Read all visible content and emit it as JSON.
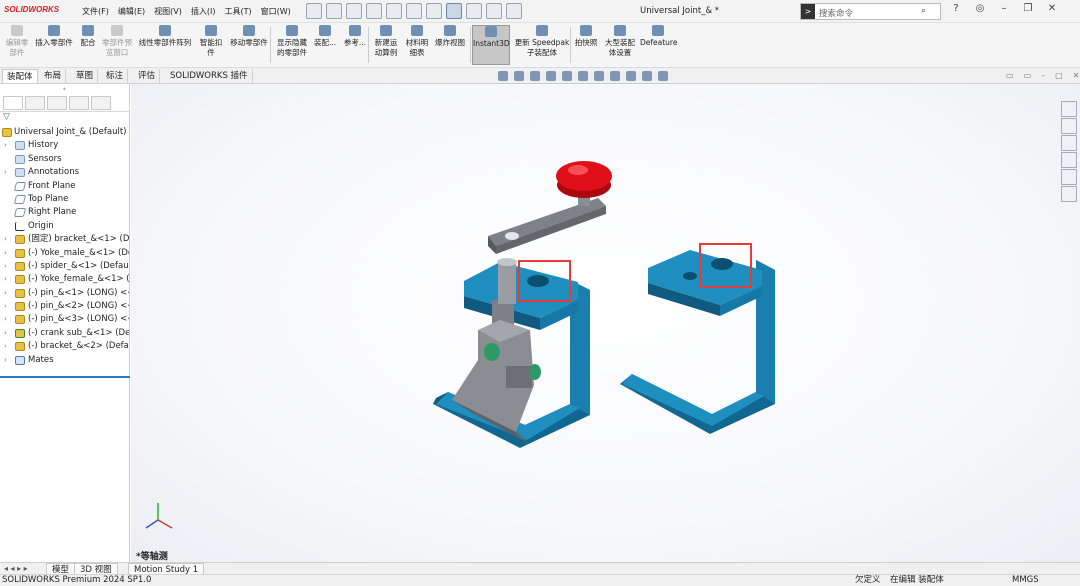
{
  "app": {
    "logo": "SOLIDWORKS",
    "window_title": "Universal Joint_& *",
    "menu": [
      "文件(F)",
      "编辑(E)",
      "视图(V)",
      "插入(I)",
      "工具(T)",
      "窗口(W)"
    ],
    "search_placeholder": "搜索命令"
  },
  "ribbon": {
    "buttons": [
      {
        "label": "编辑零\n部件",
        "dim": true
      },
      {
        "label": "插入零部件",
        "dim": false
      },
      {
        "label": "配合",
        "dim": false
      },
      {
        "label": "零部件预\n览窗口",
        "dim": true
      },
      {
        "label": "线性零部件阵列",
        "dim": false
      },
      {
        "label": "智能扣\n件",
        "dim": false
      },
      {
        "label": "移动零部件",
        "dim": false
      },
      {
        "label": "显示隐藏\n的零部件",
        "dim": false
      },
      {
        "label": "装配...",
        "dim": false
      },
      {
        "label": "参考...",
        "dim": false
      },
      {
        "label": "新建运\n动算例",
        "dim": false
      },
      {
        "label": "材料明\n细表",
        "dim": false
      },
      {
        "label": "爆炸视图",
        "dim": false
      },
      {
        "label": "Instant3D",
        "dim": false,
        "active": true
      },
      {
        "label": "更新 Speedpak\n子装配体",
        "dim": false
      },
      {
        "label": "拍快照",
        "dim": false
      },
      {
        "label": "大型装配\n体设置",
        "dim": false
      },
      {
        "label": "Defeature",
        "dim": false
      }
    ]
  },
  "command_tabs": [
    "装配体",
    "布局",
    "草图",
    "标注",
    "评估",
    "SOLIDWORKS 插件"
  ],
  "tree": {
    "root": "Universal Joint_& (Default) <",
    "items": [
      {
        "label": "History",
        "icon": "folder",
        "exp": true
      },
      {
        "label": "Sensors",
        "icon": "folder",
        "exp": false
      },
      {
        "label": "Annotations",
        "icon": "folder",
        "exp": true
      },
      {
        "label": "Front Plane",
        "icon": "plane",
        "exp": false
      },
      {
        "label": "Top Plane",
        "icon": "plane",
        "exp": false
      },
      {
        "label": "Right Plane",
        "icon": "plane",
        "exp": false
      },
      {
        "label": "Origin",
        "icon": "origin",
        "exp": false
      },
      {
        "label": "(固定) bracket_&<1> (De",
        "icon": "gear",
        "exp": true
      },
      {
        "label": "(-) Yoke_male_&<1> (De",
        "icon": "gear",
        "exp": true
      },
      {
        "label": "(-) spider_&<1> (Default",
        "icon": "gear",
        "exp": true
      },
      {
        "label": "(-) Yoke_female_&<1> (D",
        "icon": "gear",
        "exp": true
      },
      {
        "label": "(-) pin_&<1> (LONG) <<",
        "icon": "gear",
        "exp": true
      },
      {
        "label": "(-) pin_&<2> (LONG) <<",
        "icon": "gear",
        "exp": true
      },
      {
        "label": "(-) pin_&<3> (LONG) <<",
        "icon": "gear",
        "exp": true
      },
      {
        "label": "(-) crank sub_&<1> (Defa",
        "icon": "sub",
        "exp": true
      },
      {
        "label": "(-) bracket_&<2> (Defau",
        "icon": "gear",
        "exp": true
      },
      {
        "label": "Mates",
        "icon": "mates",
        "exp": true
      }
    ]
  },
  "graphics": {
    "view_name": "*等轴测",
    "colors": {
      "bracket": "#1f8fc0",
      "bracket_dark": "#11678f",
      "knob": "#e0101a",
      "metal": "#8a8e93",
      "highlight_box": "#e53b3b"
    }
  },
  "bottom_tabs": [
    "模型",
    "3D 视图",
    "Motion Study 1"
  ],
  "status": {
    "product": "SOLIDWORKS Premium 2024 SP1.0",
    "defined": "欠定义",
    "editing": "在编辑 装配体",
    "units": "MMGS"
  }
}
